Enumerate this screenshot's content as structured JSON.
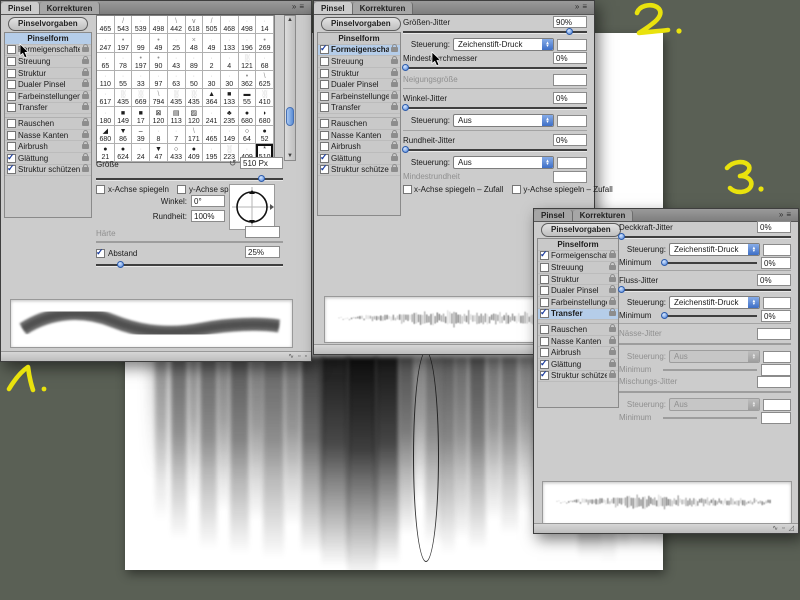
{
  "colors": {
    "desktop_bg": "#5a6055",
    "panel_bg": "#cccccc",
    "selection_blue": "#b5cde9",
    "control_blue": "#4f82d2",
    "annotation_yellow": "#e9e20d"
  },
  "window": {
    "tabs": [
      {
        "label": "Pinsel",
        "active": true
      },
      {
        "label": "Korrekturen",
        "active": false
      }
    ],
    "presets_button": "Pinselvorgaben"
  },
  "sidebar_labels": [
    "Pinselform",
    "Formeigenschaften",
    "Streuung",
    "Struktur",
    "Dualer Pinsel",
    "Farbeinstellungen",
    "Transfer",
    "Rauschen",
    "Nasse Kanten",
    "Airbrush",
    "Glättung",
    "Struktur schützen"
  ],
  "sidebar_group_break": 7,
  "panel1": {
    "selected": "Pinselform",
    "selected_blue": true,
    "checked": [
      "Glättung",
      "Struktur schützen"
    ],
    "grid": {
      "numbers": [
        [
          465,
          543,
          539,
          498,
          442,
          618,
          505,
          468,
          498,
          14
        ],
        [
          247,
          197,
          99,
          49,
          25,
          48,
          49,
          133,
          196,
          269
        ],
        [
          65,
          78,
          197,
          90,
          43,
          89,
          2,
          4,
          121,
          68
        ],
        [
          110,
          55,
          33,
          97,
          63,
          50,
          30,
          30,
          362,
          625
        ],
        [
          617,
          435,
          669,
          794,
          435,
          435,
          364,
          133,
          55,
          410
        ],
        [
          180,
          149,
          17,
          120,
          113,
          120,
          241,
          235,
          680,
          680
        ],
        [
          680,
          86,
          39,
          8,
          7,
          171,
          465,
          149,
          64,
          52
        ],
        [
          21,
          624,
          24,
          47,
          433,
          409,
          195,
          223,
          409,
          510
        ]
      ],
      "glyphs": [
        [
          "·",
          "/",
          "·",
          "·",
          "\\",
          "∨",
          "/",
          "·",
          "·",
          "·"
        ],
        [
          "·",
          "•",
          "·",
          "•",
          "·",
          "×",
          "·",
          "·",
          "·",
          "•"
        ],
        [
          "·",
          "·",
          "•",
          "•",
          "·",
          "·",
          "·",
          "·",
          "░",
          "·"
        ],
        [
          "·",
          "·",
          "·",
          "·",
          "·",
          "·",
          "·",
          "·",
          "•",
          "\\"
        ],
        [
          "·",
          "░",
          "░",
          "\\",
          "░",
          "░",
          "▲",
          "■",
          "▬",
          "░"
        ],
        [
          "·",
          "■",
          "■",
          "⊠",
          "▤",
          "▨",
          "·",
          "♣",
          "●",
          "◗"
        ],
        [
          "◢",
          "▼",
          "–",
          "·",
          "·",
          "\\",
          "·",
          "·",
          "○",
          "●"
        ],
        [
          "●",
          "●",
          "·",
          "▼",
          "○",
          "●",
          "·",
          "░",
          "·",
          "*"
        ]
      ],
      "selected_value": 510
    },
    "size_label": "Größe",
    "size_value": "510 Px",
    "size_slider_pct": 88,
    "flip_x_label": "x-Achse spiegeln",
    "flip_y_label": "y-Achse spiegeln",
    "angle_label": "Winkel:",
    "angle_value": "0°",
    "roundness_label": "Rundheit:",
    "roundness_value": "100%",
    "hardness_label": "Härte",
    "hardness_value": "",
    "spacing_label": "Abstand",
    "spacing_checked": true,
    "spacing_value": "25%",
    "spacing_slider_pct": 13
  },
  "panel2": {
    "selected": "Formeigenschaften",
    "selected_blue": true,
    "checked": [
      "Formeigenschaften",
      "Glättung",
      "Struktur schützen"
    ],
    "rows": [
      {
        "t": "jitter",
        "label": "Größen-Jitter",
        "value": "90%",
        "pct": 90
      },
      {
        "t": "ctrl",
        "label": "Steuerung:",
        "value": "Zeichenstift-Druck"
      },
      {
        "t": "jitter",
        "label": "Mindestdurchmesser",
        "value": "0%",
        "pct": 1
      },
      {
        "t": "fdis",
        "label": "Neigungsgröße"
      },
      {
        "t": "div"
      },
      {
        "t": "jitter",
        "label": "Winkel-Jitter",
        "value": "0%",
        "pct": 1
      },
      {
        "t": "ctrl",
        "label": "Steuerung:",
        "value": "Aus"
      },
      {
        "t": "div"
      },
      {
        "t": "jitter",
        "label": "Rundheit-Jitter",
        "value": "0%",
        "pct": 1
      },
      {
        "t": "ctrl",
        "label": "Steuerung:",
        "value": "Aus"
      },
      {
        "t": "fdis",
        "label": "Mindestrundheit"
      },
      {
        "t": "checks",
        "items": [
          "x-Achse spiegeln – Zufall",
          "y-Achse spiegeln – Zufall"
        ]
      }
    ]
  },
  "panel3": {
    "selected": "Transfer",
    "selected_blue": true,
    "checked": [
      "Formeigenschaften",
      "Transfer",
      "Glättung",
      "Struktur schützen"
    ],
    "rows": [
      {
        "t": "jitter",
        "label": "Deckkraft-Jitter",
        "value": "0%",
        "pct": 1
      },
      {
        "t": "ctrl",
        "label": "Steuerung:",
        "value": "Zeichenstift-Druck"
      },
      {
        "t": "min",
        "label": "Minimum",
        "value": "0%",
        "pct": 1
      },
      {
        "t": "div"
      },
      {
        "t": "jitter",
        "label": "Fluss-Jitter",
        "value": "0%",
        "pct": 1
      },
      {
        "t": "ctrl",
        "label": "Steuerung:",
        "value": "Zeichenstift-Druck"
      },
      {
        "t": "min",
        "label": "Minimum",
        "value": "0%",
        "pct": 1
      },
      {
        "t": "div"
      },
      {
        "t": "fdis",
        "label": "Nässe-Jitter"
      },
      {
        "t": "line"
      },
      {
        "t": "ctrl",
        "label": "Steuerung:",
        "value": "Aus",
        "dis": true
      },
      {
        "t": "min",
        "label": "Minimum",
        "value": "",
        "dis": true
      },
      {
        "t": "fdis",
        "label": "Mischungs-Jitter"
      },
      {
        "t": "line"
      },
      {
        "t": "ctrl",
        "label": "Steuerung:",
        "value": "Aus",
        "dis": true
      },
      {
        "t": "min",
        "label": "Minimum",
        "value": "",
        "dis": true
      }
    ]
  },
  "annotations": [
    "1.",
    "2.",
    "3."
  ]
}
